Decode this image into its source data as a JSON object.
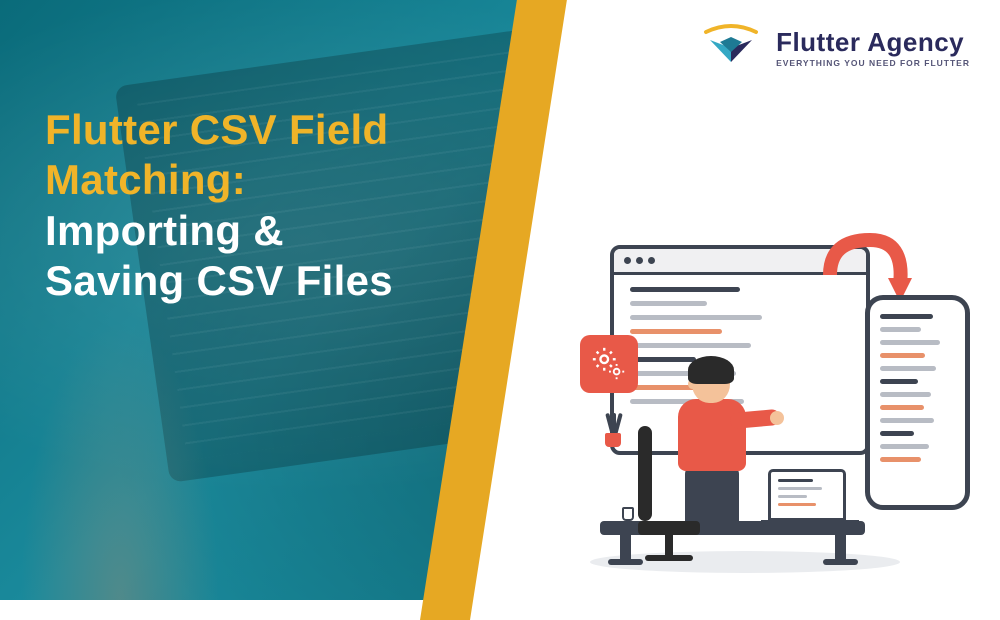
{
  "title": {
    "line1": "Flutter CSV Field",
    "line2": "Matching:",
    "line3": "Importing &",
    "line4": "Saving CSV Files"
  },
  "logo": {
    "name": "Flutter Agency",
    "tagline": "EVERYTHING YOU NEED FOR FLUTTER"
  },
  "colors": {
    "teal": "#0f7585",
    "yellow": "#e6a823",
    "titleYellow": "#f0b429",
    "accentRed": "#e85948",
    "navy": "#2a2a5c",
    "darkSlate": "#3d4451"
  }
}
